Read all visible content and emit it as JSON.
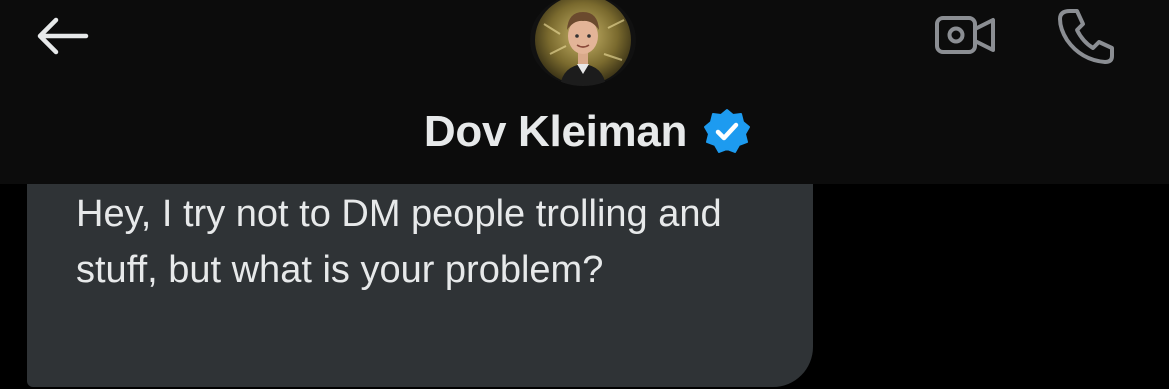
{
  "conversation": {
    "display_name": "Dov Kleiman",
    "verified": true,
    "verified_color": "#1d9bf0",
    "icons": {
      "back": "arrow-left-icon",
      "avatar": "profile-avatar",
      "video": "video-call-icon",
      "call": "phone-icon",
      "verified": "verified-badge-icon"
    }
  },
  "message": {
    "direction": "incoming",
    "text": "Hey, I try not to DM people trolling and stuff, but what is your problem?"
  },
  "colors": {
    "background": "#000000",
    "header": "#0c0c0c",
    "bubble": "#2f3336",
    "text": "#e7e9ea",
    "icon": "#8b8e93"
  }
}
